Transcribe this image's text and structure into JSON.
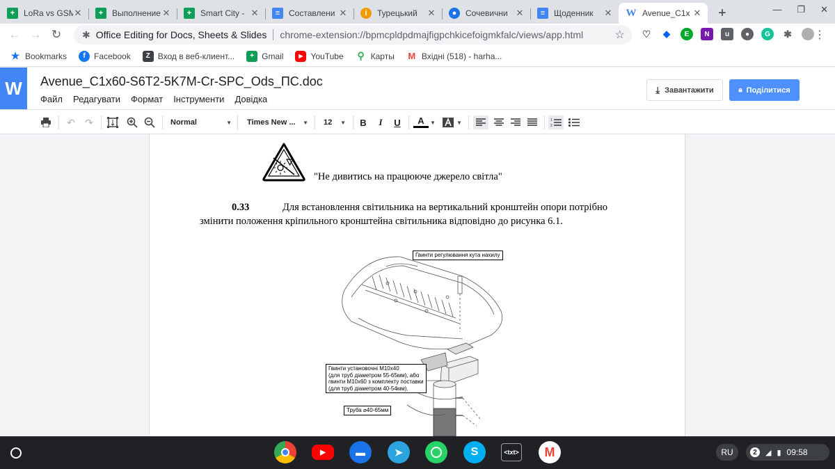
{
  "browser": {
    "tabs": [
      {
        "title": "LoRa vs GSM",
        "icon": "sheets-icon",
        "active": false
      },
      {
        "title": "Выполнение",
        "icon": "sheets-icon",
        "active": false
      },
      {
        "title": "Smart City -",
        "icon": "sheets-icon",
        "active": false
      },
      {
        "title": "Составлени",
        "icon": "docs-icon",
        "active": false
      },
      {
        "title": "Турецький",
        "icon": "orange-info-icon",
        "active": false
      },
      {
        "title": "Сочевични",
        "icon": "steam-like-icon",
        "active": false
      },
      {
        "title": "Щоденник",
        "icon": "docs-icon",
        "active": false
      },
      {
        "title": "Avenue_C1x",
        "icon": "word-icon",
        "active": true
      }
    ],
    "omnibox": {
      "ext_name": "Office Editing for Docs, Sheets & Slides",
      "url": "chrome-extension://bpmcpldpdmajfigpchkicefoigmkfalc/views/app.html"
    },
    "bookmarks": [
      {
        "label": "Bookmarks",
        "icon": "star-icon",
        "color": "#1a73e8"
      },
      {
        "label": "Facebook",
        "icon": "facebook-icon",
        "color": "#1877f2"
      },
      {
        "label": "Вход в веб-клиент...",
        "icon": "zimbra-icon",
        "color": "#d93025"
      },
      {
        "label": "Gmail",
        "icon": "sheets-green-icon",
        "color": "#0f9d58"
      },
      {
        "label": "YouTube",
        "icon": "youtube-icon",
        "color": "#ff0000"
      },
      {
        "label": "Карты",
        "icon": "maps-icon",
        "color": "#34a853"
      },
      {
        "label": "Вхідні (518) - harha...",
        "icon": "gmail-icon",
        "color": "#ea4335"
      }
    ]
  },
  "app": {
    "logo": "W",
    "doc_title": "Avenue_C1x60-S6T2-5K7M-Cr-SPC_Ods_ПС.doc",
    "menu": [
      "Файл",
      "Редагувати",
      "Формат",
      "Інструменти",
      "Довідка"
    ],
    "download_label": "Завантажити",
    "share_label": "Поділитися"
  },
  "toolbar": {
    "style_value": "Normal",
    "font_value": "Times New ...",
    "size_value": "12",
    "bold": "B",
    "italic": "I",
    "underline": "U",
    "font_color": "A"
  },
  "document": {
    "warning_caption": "\"Не дивитись на працююче джерело світла\"",
    "para_number": "0.33",
    "para_line1": "Для встановлення світильника на вертикальний кронштейн опори потрібно",
    "para_line2": "змінити положення кріпильного кронштейна світильника відповідно до рисунка 6.1.",
    "figure_labels": {
      "tilt_screws": "Гвинти регулювання кута нахилу",
      "mount_screws_1": "Гвинти установочні М10х40",
      "mount_screws_2": "(для труб діаметром 55-65мм), або",
      "mount_screws_3": "гвинти М10х60 з комплекту поставки",
      "mount_screws_4": "(для труб діаметром 40-54мм).",
      "pipe": "Труба ⌀40-65мм"
    }
  },
  "shelf": {
    "apps": [
      {
        "name": "chrome-app",
        "color": "#ffffff"
      },
      {
        "name": "youtube-app",
        "color": "#ff0000"
      },
      {
        "name": "files-app",
        "color": "#1a73e8"
      },
      {
        "name": "telegram-app",
        "color": "#2aa3df"
      },
      {
        "name": "whatsapp-app",
        "color": "#25d366"
      },
      {
        "name": "skype-app",
        "color": "#00aff0"
      },
      {
        "name": "text-app",
        "color": "#202124"
      },
      {
        "name": "gmail-app",
        "color": "#ffffff"
      }
    ],
    "text_app_label": "<txt>",
    "language": "RU",
    "notifications": "2",
    "time": "09:58"
  }
}
